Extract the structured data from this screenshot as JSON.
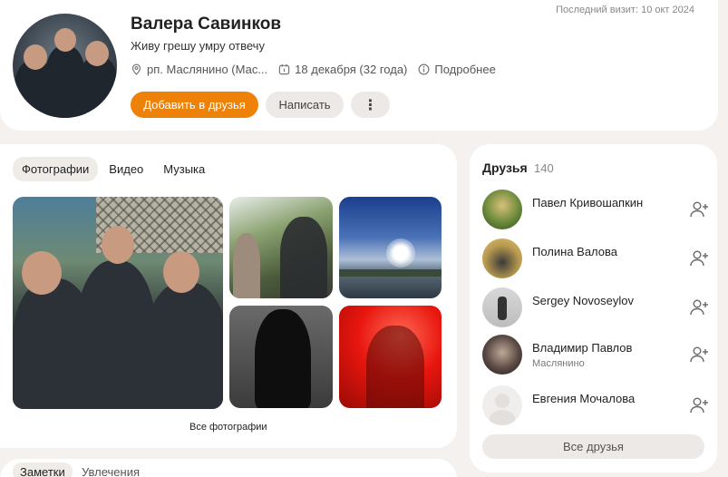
{
  "profile": {
    "name": "Валера Савинков",
    "status": "Живу грешу умру отвечу",
    "last_visit": "Последний визит: 10 окт 2024",
    "location": "рп. Маслянино (Мас...",
    "birthday": "18 декабря (32 года)",
    "more_info": "Подробнее",
    "icons": {
      "location": "location-pin-icon",
      "birthday": "calendar-icon",
      "info": "info-icon"
    }
  },
  "actions": {
    "add_friend": "Добавить в друзья",
    "message": "Написать",
    "more": "⋮"
  },
  "media": {
    "tabs": [
      {
        "label": "Фотографии",
        "active": true
      },
      {
        "label": "Видео",
        "active": false
      },
      {
        "label": "Музыка",
        "active": false
      }
    ],
    "all_photos": "Все фотографии"
  },
  "friends": {
    "title": "Друзья",
    "count": "140",
    "items": [
      {
        "name": "Павел Кривошапкин",
        "subtitle": ""
      },
      {
        "name": "Полина Валова",
        "subtitle": ""
      },
      {
        "name": "Sergey Novoseylov",
        "subtitle": ""
      },
      {
        "name": "Владимир Павлов",
        "subtitle": "Маслянино"
      },
      {
        "name": "Евгения Мочалова",
        "subtitle": ""
      }
    ],
    "all_label": "Все друзья"
  },
  "bottom_tabs": [
    {
      "label": "Заметки",
      "active": true
    },
    {
      "label": "Увлечения",
      "active": false
    }
  ],
  "colors": {
    "accent": "#ee8208",
    "background": "#f4f1ee",
    "card": "#ffffff"
  }
}
